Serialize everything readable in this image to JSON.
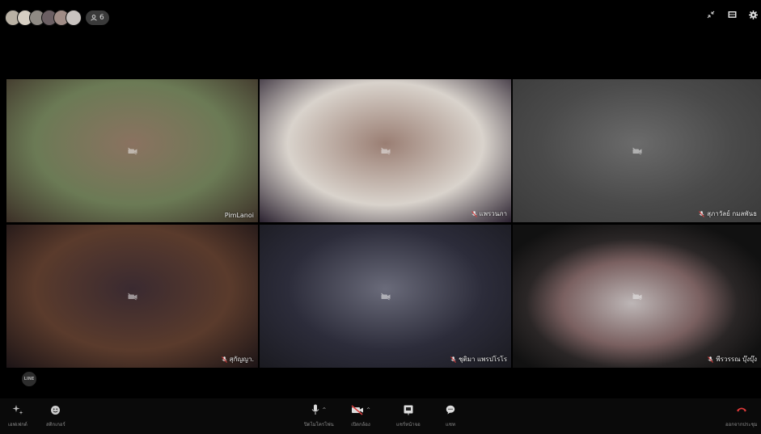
{
  "participants_count": "6",
  "top_icons": [
    "collapse-icon",
    "filmstrip-icon",
    "settings-icon"
  ],
  "tiles": [
    {
      "name": "PimLanoi",
      "mic_muted": false,
      "bg": [
        "#6b7a55",
        "#8a7260",
        "#3c3027"
      ]
    },
    {
      "name": "แพรวนภา",
      "mic_muted": true,
      "bg": [
        "#d9d3cc",
        "#9a7e73",
        "#2b2230"
      ]
    },
    {
      "name": "สุภาวัลย์ กมลพันธ",
      "mic_muted": true,
      "bg": [
        "#4a4a4a",
        "#6b6b6b",
        "#3a3a3a"
      ]
    },
    {
      "name": "สุกัญญา.",
      "mic_muted": true,
      "bg": [
        "#5a3b2c",
        "#3a2a30",
        "#1c1416"
      ]
    },
    {
      "name": "ชุติมา แพรปโรโร",
      "mic_muted": true,
      "bg": [
        "#2c2c3a",
        "#6a6b7a",
        "#1a1a20"
      ]
    },
    {
      "name": "พีรวรรณ บุ๊งบุ๊ง",
      "mic_muted": true,
      "bg": [
        "#2a2626",
        "#bdb6b6",
        "#3a2a28"
      ]
    }
  ],
  "line_logo": "LINE",
  "bottom": {
    "effects": "เอฟเฟกต์",
    "stickers": "สติกเกอร์",
    "mic": "ปิดไมโครโฟน",
    "camera": "เปิดกล้อง",
    "share": "แชร์หน้าจอ",
    "chat": "แชท",
    "leave": "ออกจากประชุม"
  },
  "colors": {
    "leave_red": "#e03a3a",
    "muted_red": "#d94040"
  }
}
